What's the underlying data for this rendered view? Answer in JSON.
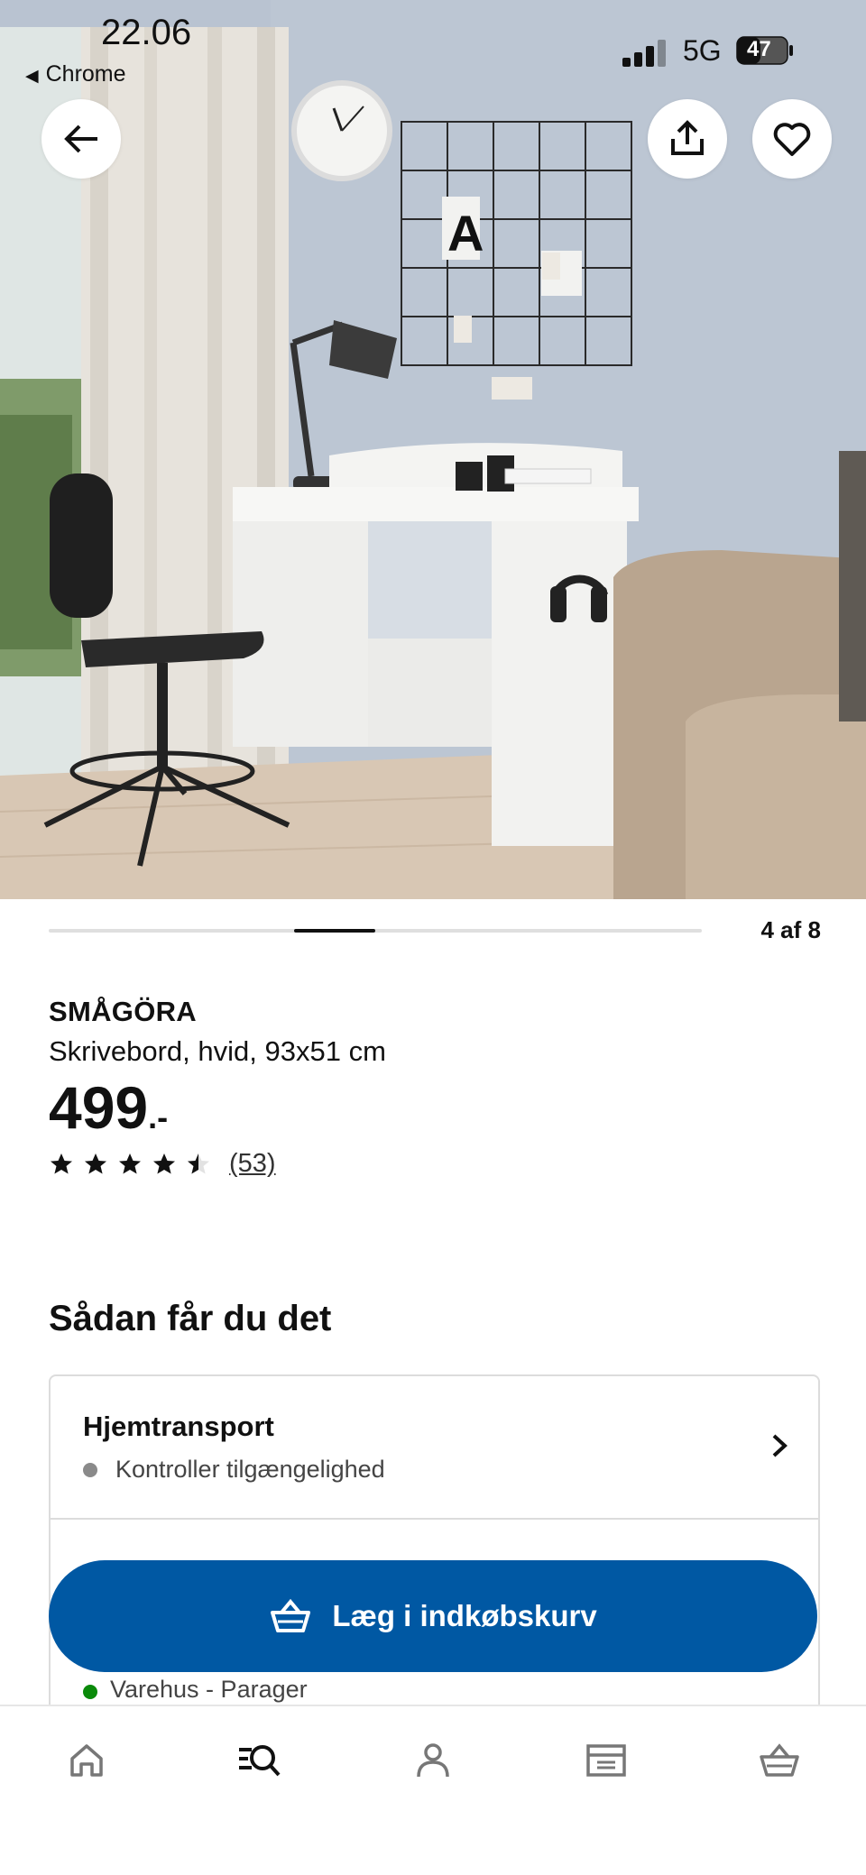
{
  "status_bar": {
    "time": "22.06",
    "back_app": "Chrome",
    "network": "5G",
    "battery": "47"
  },
  "hero": {
    "poster_letter": "A"
  },
  "gallery": {
    "counter": "4 af 8",
    "current": 4,
    "total": 8
  },
  "product": {
    "name": "SMÅGÖRA",
    "description": "Skrivebord, hvid, 93x51 cm",
    "price": "499",
    "price_suffix": ".-",
    "rating": 4.5,
    "review_count": "(53)"
  },
  "delivery": {
    "section_title": "Sådan får du det",
    "home_delivery_title": "Hjemtransport",
    "home_delivery_status": "Kontroller tilgængelighed",
    "second_row_text": "Varehus - Parager"
  },
  "actions": {
    "add_to_cart": "Læg i indkøbskurv"
  },
  "bottom_nav": {
    "items": [
      "home-icon",
      "search-icon",
      "profile-icon",
      "store-icon",
      "basket-icon"
    ]
  },
  "colors": {
    "accent": "#0058a3",
    "status_unknown": "#8a8a8a",
    "status_available": "#0a8a0a"
  }
}
